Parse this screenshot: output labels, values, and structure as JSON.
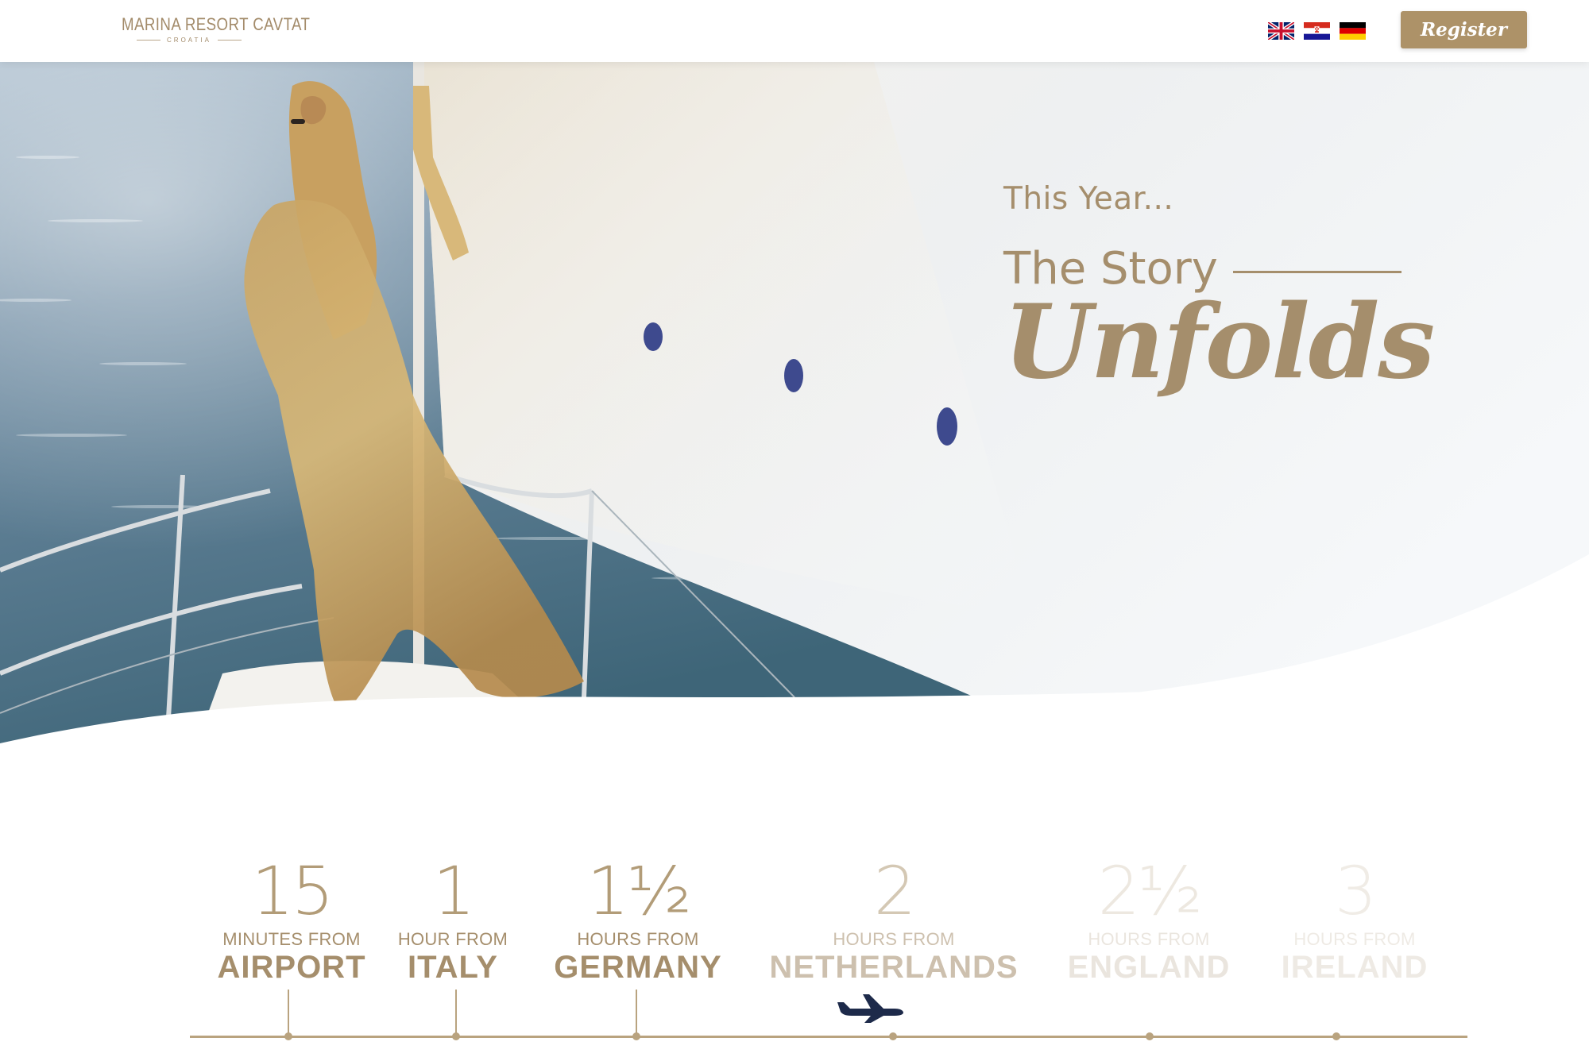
{
  "header": {
    "logo_name": "MARINA RESORT CAVTAT",
    "logo_sub": "CROATIA",
    "register_label": "Register",
    "languages": [
      {
        "icon": "uk-flag-icon",
        "name": "English"
      },
      {
        "icon": "croatia-flag-icon",
        "name": "Croatian"
      },
      {
        "icon": "germany-flag-icon",
        "name": "German"
      }
    ]
  },
  "hero": {
    "kicker": "This Year...",
    "title_line1": "The Story",
    "title_line2": "Unfolds"
  },
  "timeline": {
    "stops": [
      {
        "number": "15",
        "unit": "MINUTES FROM",
        "place": "AIRPORT"
      },
      {
        "number": "1",
        "unit": "HOUR FROM",
        "place": "ITALY"
      },
      {
        "number": "1½",
        "unit": "HOURS FROM",
        "place": "GERMANY"
      },
      {
        "number": "2",
        "unit": "HOURS FROM",
        "place": "NETHERLANDS"
      },
      {
        "number": "2½",
        "unit": "HOURS FROM",
        "place": "ENGLAND"
      },
      {
        "number": "3",
        "unit": "HOURS FROM",
        "place": "IRELAND"
      }
    ],
    "current_icon": "airplane-icon"
  },
  "colors": {
    "gold": "#a58e6c",
    "button": "#ad9268",
    "navy": "#1d2a4a"
  }
}
